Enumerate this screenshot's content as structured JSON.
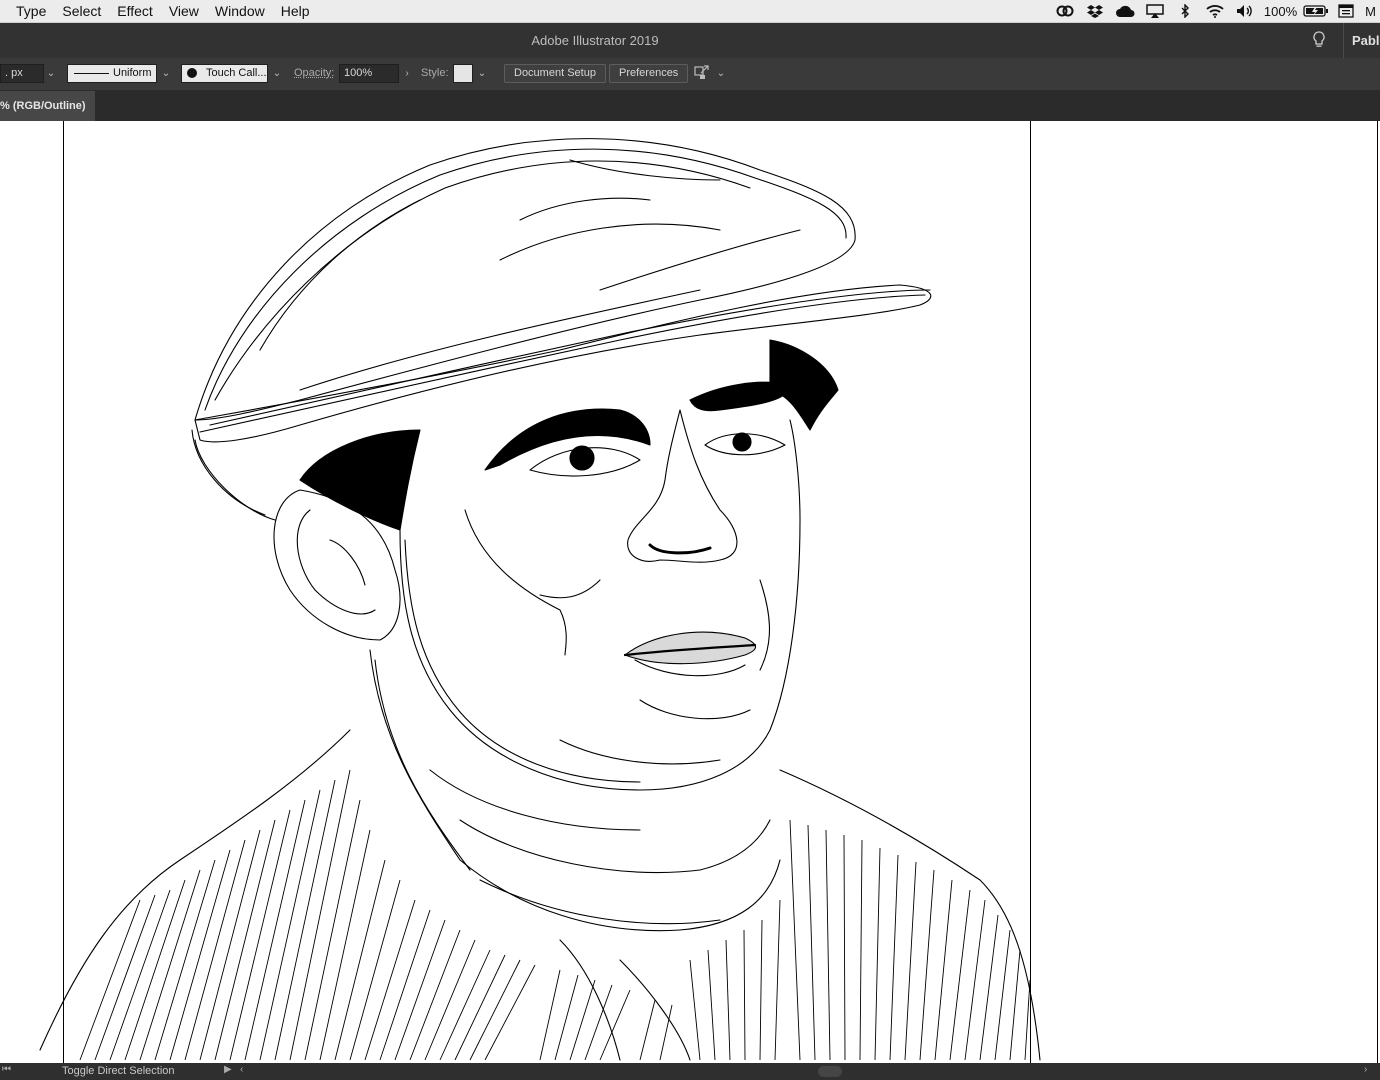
{
  "menubar": {
    "items": [
      "Type",
      "Select",
      "Effect",
      "View",
      "Window",
      "Help"
    ],
    "battery_percent": "100%",
    "edge_letter": "M",
    "icons": [
      "creative-cloud-icon",
      "dropbox-icon",
      "cloud-icon",
      "airplay-icon",
      "bluetooth-icon",
      "wifi-icon",
      "volume-icon",
      "battery-icon",
      "menu-extra-icon"
    ]
  },
  "titlebar": {
    "title": "Adobe Illustrator 2019",
    "user": "Pablo"
  },
  "controlbar": {
    "stroke_weight": ". px",
    "stroke_profile": "Uniform",
    "brush": "Touch Call...",
    "opacity_label": "Opacity:",
    "opacity_value": "100%",
    "style_label": "Style:",
    "document_setup": "Document Setup",
    "preferences": "Preferences"
  },
  "tabbar": {
    "document_tab": "% (RGB/Outline)"
  },
  "statusbar": {
    "text": "Toggle Direct Selection"
  },
  "colors": {
    "menubar_bg": "#ececec",
    "app_chrome": "#323232",
    "controlbar_bg": "#3a3a3a",
    "tab_active": "#474747",
    "canvas": "#ffffff"
  }
}
